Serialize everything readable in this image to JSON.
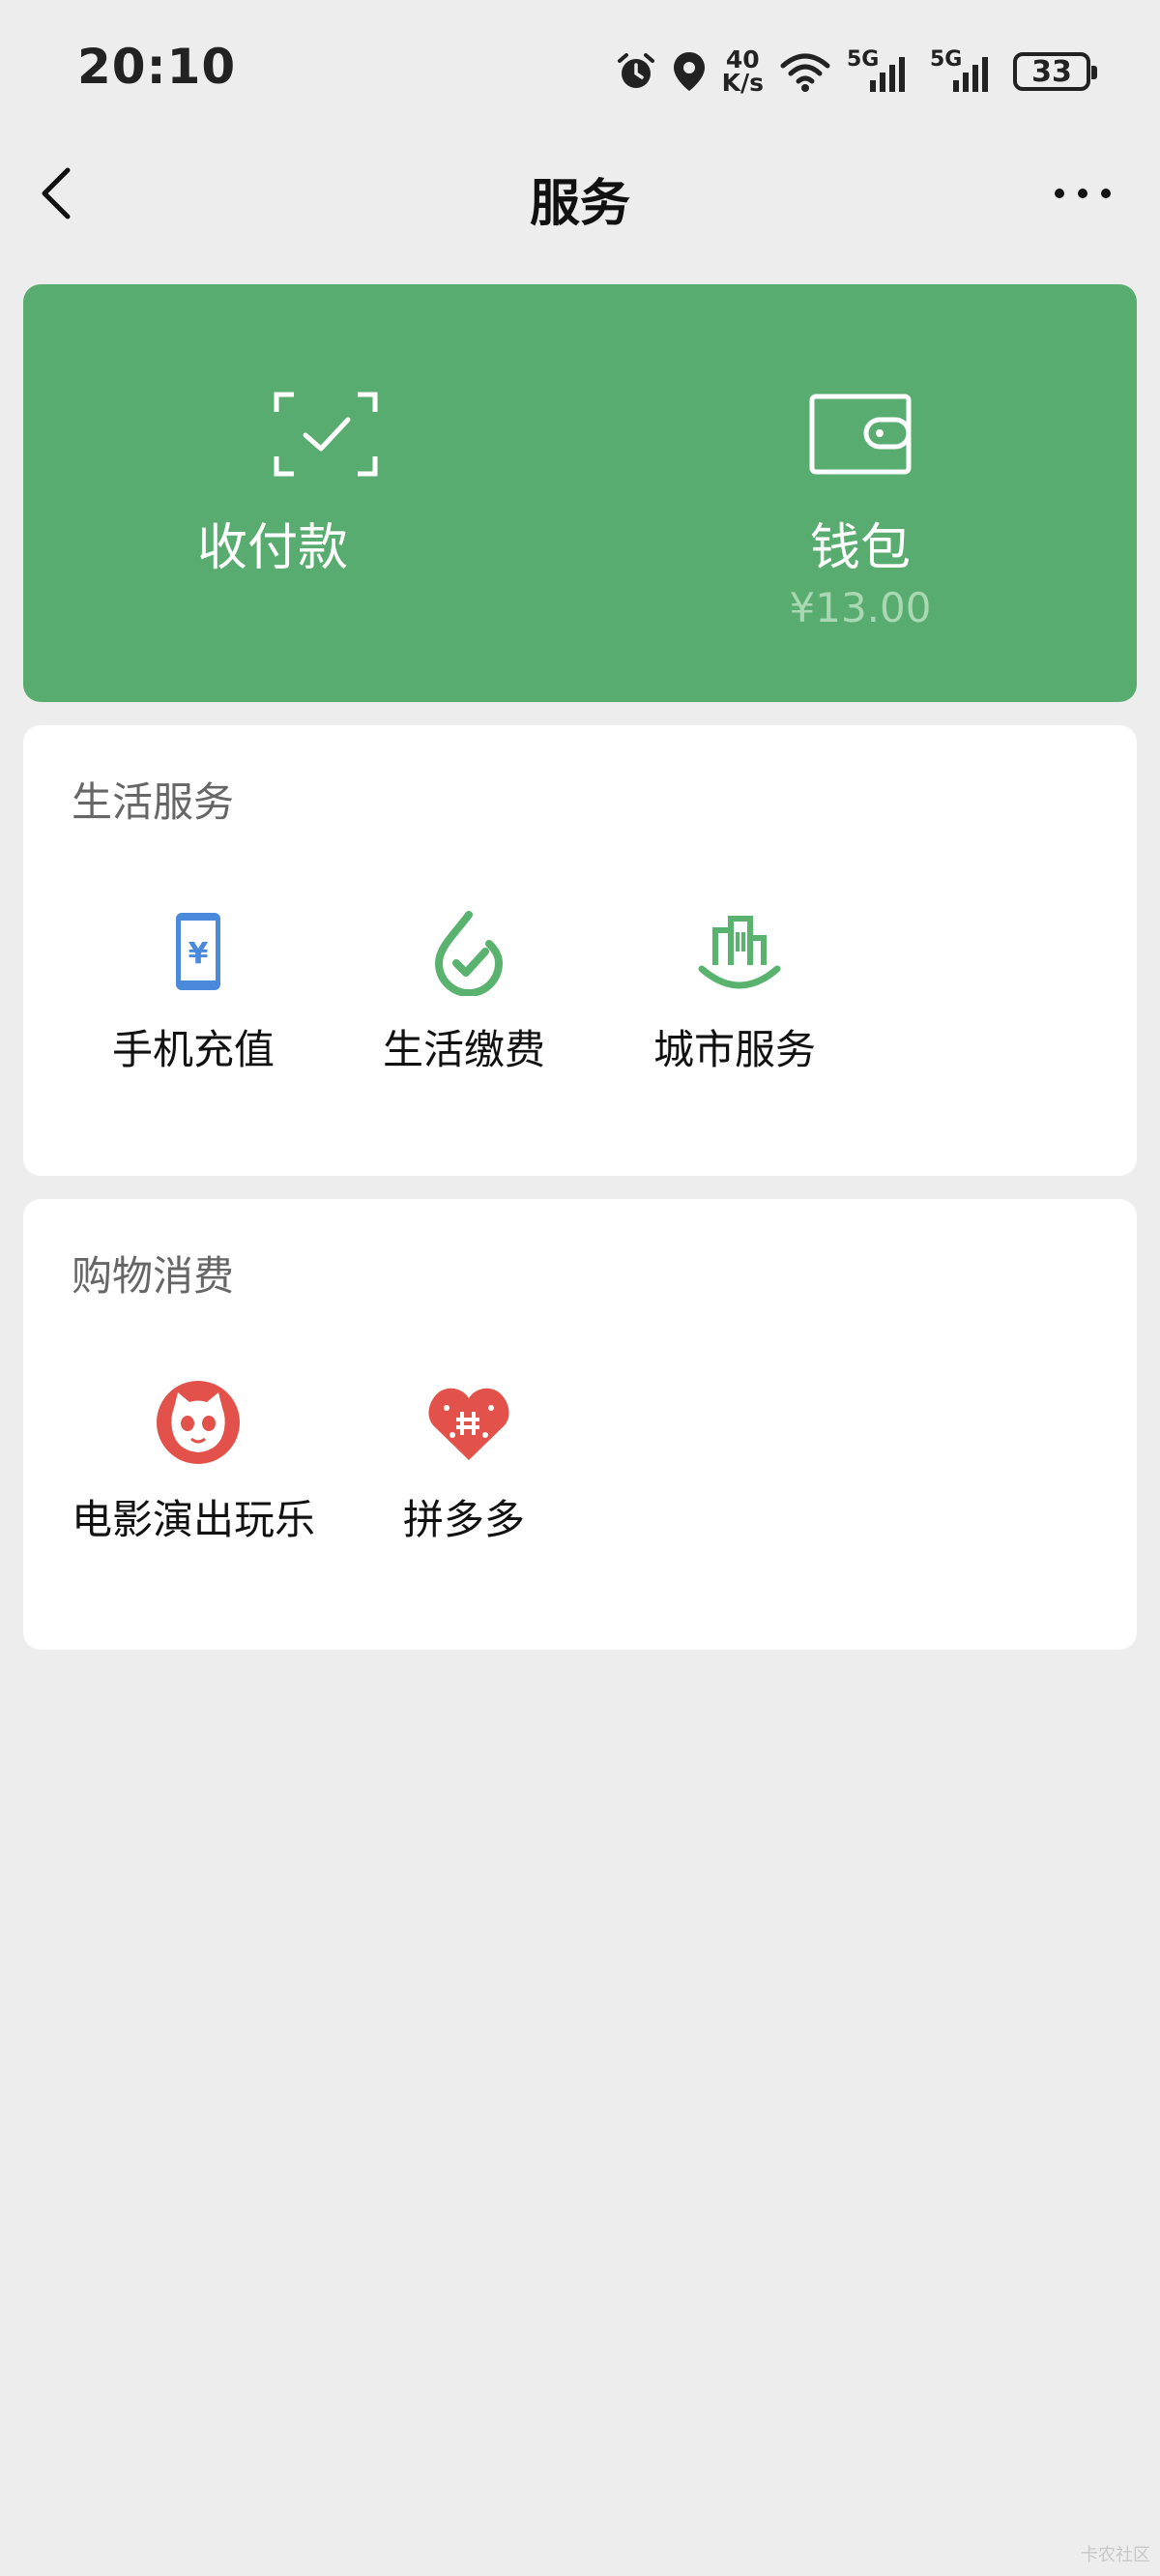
{
  "status_bar": {
    "time": "20:10",
    "net_speed_value": "40",
    "net_speed_unit": "K/s",
    "signal_1_label": "5G",
    "signal_2_label": "5G",
    "battery": "33",
    "icons": [
      "alarm-icon",
      "location-icon",
      "wifi-icon",
      "signal-icon",
      "signal-icon",
      "battery-icon"
    ]
  },
  "nav": {
    "title": "服务",
    "icons": [
      "back-icon",
      "more-icon"
    ]
  },
  "top_card": {
    "color": "#59ac6f",
    "pay": {
      "label": "收付款",
      "icon": "scan-check-icon"
    },
    "wallet": {
      "label": "钱包",
      "balance": "¥13.00",
      "icon": "wallet-icon"
    }
  },
  "life_services": {
    "title": "生活服务",
    "items": [
      {
        "label": "手机充值",
        "icon": "phone-recharge-icon",
        "color": "#4a89dc"
      },
      {
        "label": "生活缴费",
        "icon": "bill-payment-icon",
        "color": "#59b36f"
      },
      {
        "label": "城市服务",
        "icon": "city-services-icon",
        "color": "#59b36f"
      }
    ]
  },
  "shopping": {
    "title": "购物消费",
    "items": [
      {
        "label": "电影演出玩乐",
        "icon": "cat-eye-icon",
        "color": "#e2524a"
      },
      {
        "label": "拼多多",
        "icon": "pinduoduo-icon",
        "color": "#e2524a"
      }
    ]
  },
  "watermark": "卡农社区"
}
